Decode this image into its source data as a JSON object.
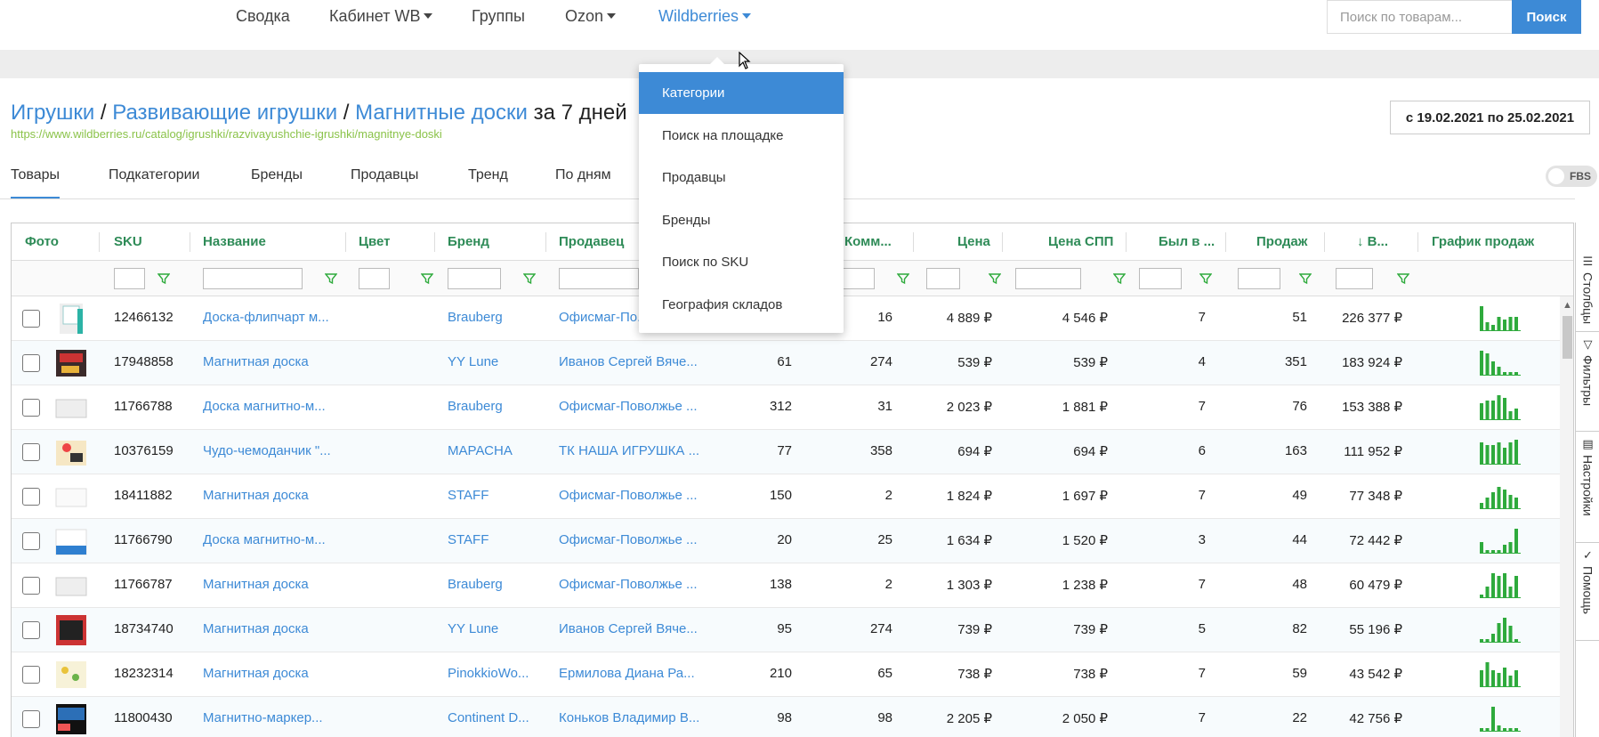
{
  "nav": {
    "items": [
      {
        "label": "Сводка",
        "dropdown": false
      },
      {
        "label": "Кабинет WB",
        "dropdown": true
      },
      {
        "label": "Группы",
        "dropdown": false
      },
      {
        "label": "Ozon",
        "dropdown": true
      },
      {
        "label": "Wildberries",
        "dropdown": true,
        "active": true
      }
    ],
    "search_placeholder": "Поиск по товарам...",
    "search_button": "Поиск"
  },
  "breadcrumb": {
    "crumbs": [
      "Игрушки",
      "Развивающие игрушки",
      "Магнитные доски"
    ],
    "separator": " / ",
    "suffix": " за 7 дней",
    "url": "https://www.wildberries.ru/catalog/igrushki/razvivayushchie-igrushki/magnitnye-doski"
  },
  "date_range": "с 19.02.2021 по 25.02.2021",
  "tabs": [
    "Товары",
    "Подкатегории",
    "Бренды",
    "Продавцы",
    "Тренд",
    "По дням"
  ],
  "fbs_label": "FBS",
  "dropdown_menu": {
    "items": [
      "Категории",
      "Поиск на площадке",
      "Продавцы",
      "Бренды",
      "Поиск по SKU",
      "География складов"
    ],
    "active_index": 0
  },
  "table": {
    "columns": [
      "Фото",
      "SKU",
      "Название",
      "Цвет",
      "Бренд",
      "Продавец",
      "Комм...",
      "Цена",
      "Цена СПП",
      "Был в ...",
      "Продаж",
      "↓ В...",
      "График продаж"
    ],
    "rows": [
      {
        "sku": "12466132",
        "name": "Доска-флипчарт м...",
        "brand": "Brauberg",
        "seller": "Офисмаг-По...",
        "c1": "",
        "comm": "16",
        "price": "4 889 ₽",
        "spp": "4 546 ₽",
        "was": "7",
        "sales": "51",
        "rev": "226 377 ₽",
        "spark": [
          9,
          3,
          2,
          5,
          4,
          5,
          5
        ]
      },
      {
        "sku": "17948858",
        "name": "Магнитная доска",
        "brand": "YY Lune",
        "seller": "Иванов Сергей Вяче...",
        "c1": "61",
        "comm": "274",
        "price": "539 ₽",
        "spp": "539 ₽",
        "was": "4",
        "sales": "351",
        "rev": "183 924 ₽",
        "spark": [
          9,
          8,
          5,
          3,
          1,
          1,
          1
        ]
      },
      {
        "sku": "11766788",
        "name": "Доска магнитно-м...",
        "brand": "Brauberg",
        "seller": "Офисмаг-Поволжье ...",
        "c1": "312",
        "comm": "31",
        "price": "2 023 ₽",
        "spp": "1 881 ₽",
        "was": "7",
        "sales": "76",
        "rev": "153 388 ₽",
        "spark": [
          6,
          7,
          7,
          9,
          8,
          3,
          4
        ]
      },
      {
        "sku": "10376159",
        "name": "Чудо-чемоданчик \"...",
        "brand": "МАРАСНА",
        "seller": "ТК НАША ИГРУШКА ...",
        "c1": "77",
        "comm": "358",
        "price": "694 ₽",
        "spp": "694 ₽",
        "was": "6",
        "sales": "163",
        "rev": "111 952 ₽",
        "spark": [
          8,
          7,
          7,
          8,
          6,
          8,
          9
        ]
      },
      {
        "sku": "18411882",
        "name": "Магнитная доска",
        "brand": "STAFF",
        "seller": "Офисмаг-Поволжье ...",
        "c1": "150",
        "comm": "2",
        "price": "1 824 ₽",
        "spp": "1 697 ₽",
        "was": "7",
        "sales": "49",
        "rev": "77 348 ₽",
        "spark": [
          2,
          4,
          6,
          8,
          7,
          5,
          4
        ]
      },
      {
        "sku": "11766790",
        "name": "Доска магнитно-м...",
        "brand": "STAFF",
        "seller": "Офисмаг-Поволжье ...",
        "c1": "20",
        "comm": "25",
        "price": "1 634 ₽",
        "spp": "1 520 ₽",
        "was": "3",
        "sales": "44",
        "rev": "72 442 ₽",
        "spark": [
          4,
          1,
          1,
          1,
          3,
          4,
          9
        ]
      },
      {
        "sku": "11766787",
        "name": "Магнитная доска",
        "brand": "Brauberg",
        "seller": "Офисмаг-Поволжье ...",
        "c1": "138",
        "comm": "2",
        "price": "1 303 ₽",
        "spp": "1 238 ₽",
        "was": "7",
        "sales": "48",
        "rev": "60 479 ₽",
        "spark": [
          1,
          4,
          9,
          8,
          9,
          4,
          8
        ]
      },
      {
        "sku": "18734740",
        "name": "Магнитная доска",
        "brand": "YY Lune",
        "seller": "Иванов Сергей Вяче...",
        "c1": "95",
        "comm": "274",
        "price": "739 ₽",
        "spp": "739 ₽",
        "was": "5",
        "sales": "82",
        "rev": "55 196 ₽",
        "spark": [
          1,
          1,
          3,
          7,
          9,
          6,
          1
        ]
      },
      {
        "sku": "18232314",
        "name": "Магнитная доска",
        "brand": "PinokkioWo...",
        "seller": "Ермилова Диана Ра...",
        "c1": "210",
        "comm": "65",
        "price": "738 ₽",
        "spp": "738 ₽",
        "was": "7",
        "sales": "59",
        "rev": "43 542 ₽",
        "spark": [
          6,
          9,
          6,
          5,
          7,
          4,
          6
        ]
      },
      {
        "sku": "11800430",
        "name": "Магнитно-маркер...",
        "brand": "Continent D...",
        "seller": "Коньков Владимир В...",
        "c1": "98",
        "comm": "98",
        "price": "2 205 ₽",
        "spp": "2 050 ₽",
        "was": "7",
        "sales": "22",
        "rev": "42 756 ₽",
        "spark": [
          1,
          1,
          9,
          2,
          1,
          1,
          1
        ]
      }
    ]
  },
  "side_panel": [
    "Столбцы",
    "Фильтры",
    "Настройки",
    "Помощь"
  ],
  "colors": {
    "accent": "#3d8ad6",
    "header_green": "#2e8b57",
    "spark_green": "#2eaa3c",
    "url_green": "#8bc34a"
  }
}
